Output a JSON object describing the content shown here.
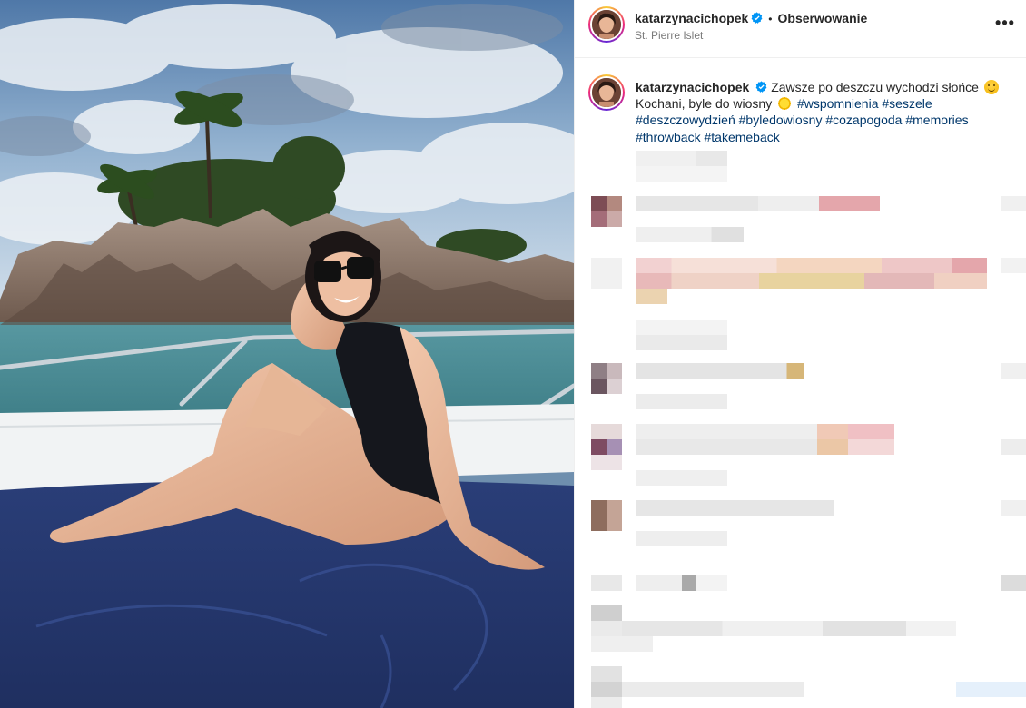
{
  "post": {
    "username": "katarzynacichopek",
    "follow_label": "Obserwowanie",
    "separator": "•",
    "location": "St. Pierre Islet",
    "more_label": "•••",
    "caption": {
      "text_before": "Zawsze po deszczu wychodzi słońce",
      "text_middle": "Kochani, byle do wiosny",
      "hashtags": [
        "#wspomnienia",
        "#seszele",
        "#deszczowydzień",
        "#byledowiosny",
        "#cozapogoda",
        "#memories",
        "#throwback",
        "#takemeback"
      ]
    }
  },
  "icons": {
    "verified": "verified-badge-icon",
    "more": "more-options-icon",
    "smile": "smiling-face-emoji",
    "sun": "sun-emoji"
  },
  "colors": {
    "accent": "#0095f6",
    "hashtag": "#00376b",
    "text": "#262626",
    "muted": "#7a7a7a",
    "border": "#efefef"
  }
}
